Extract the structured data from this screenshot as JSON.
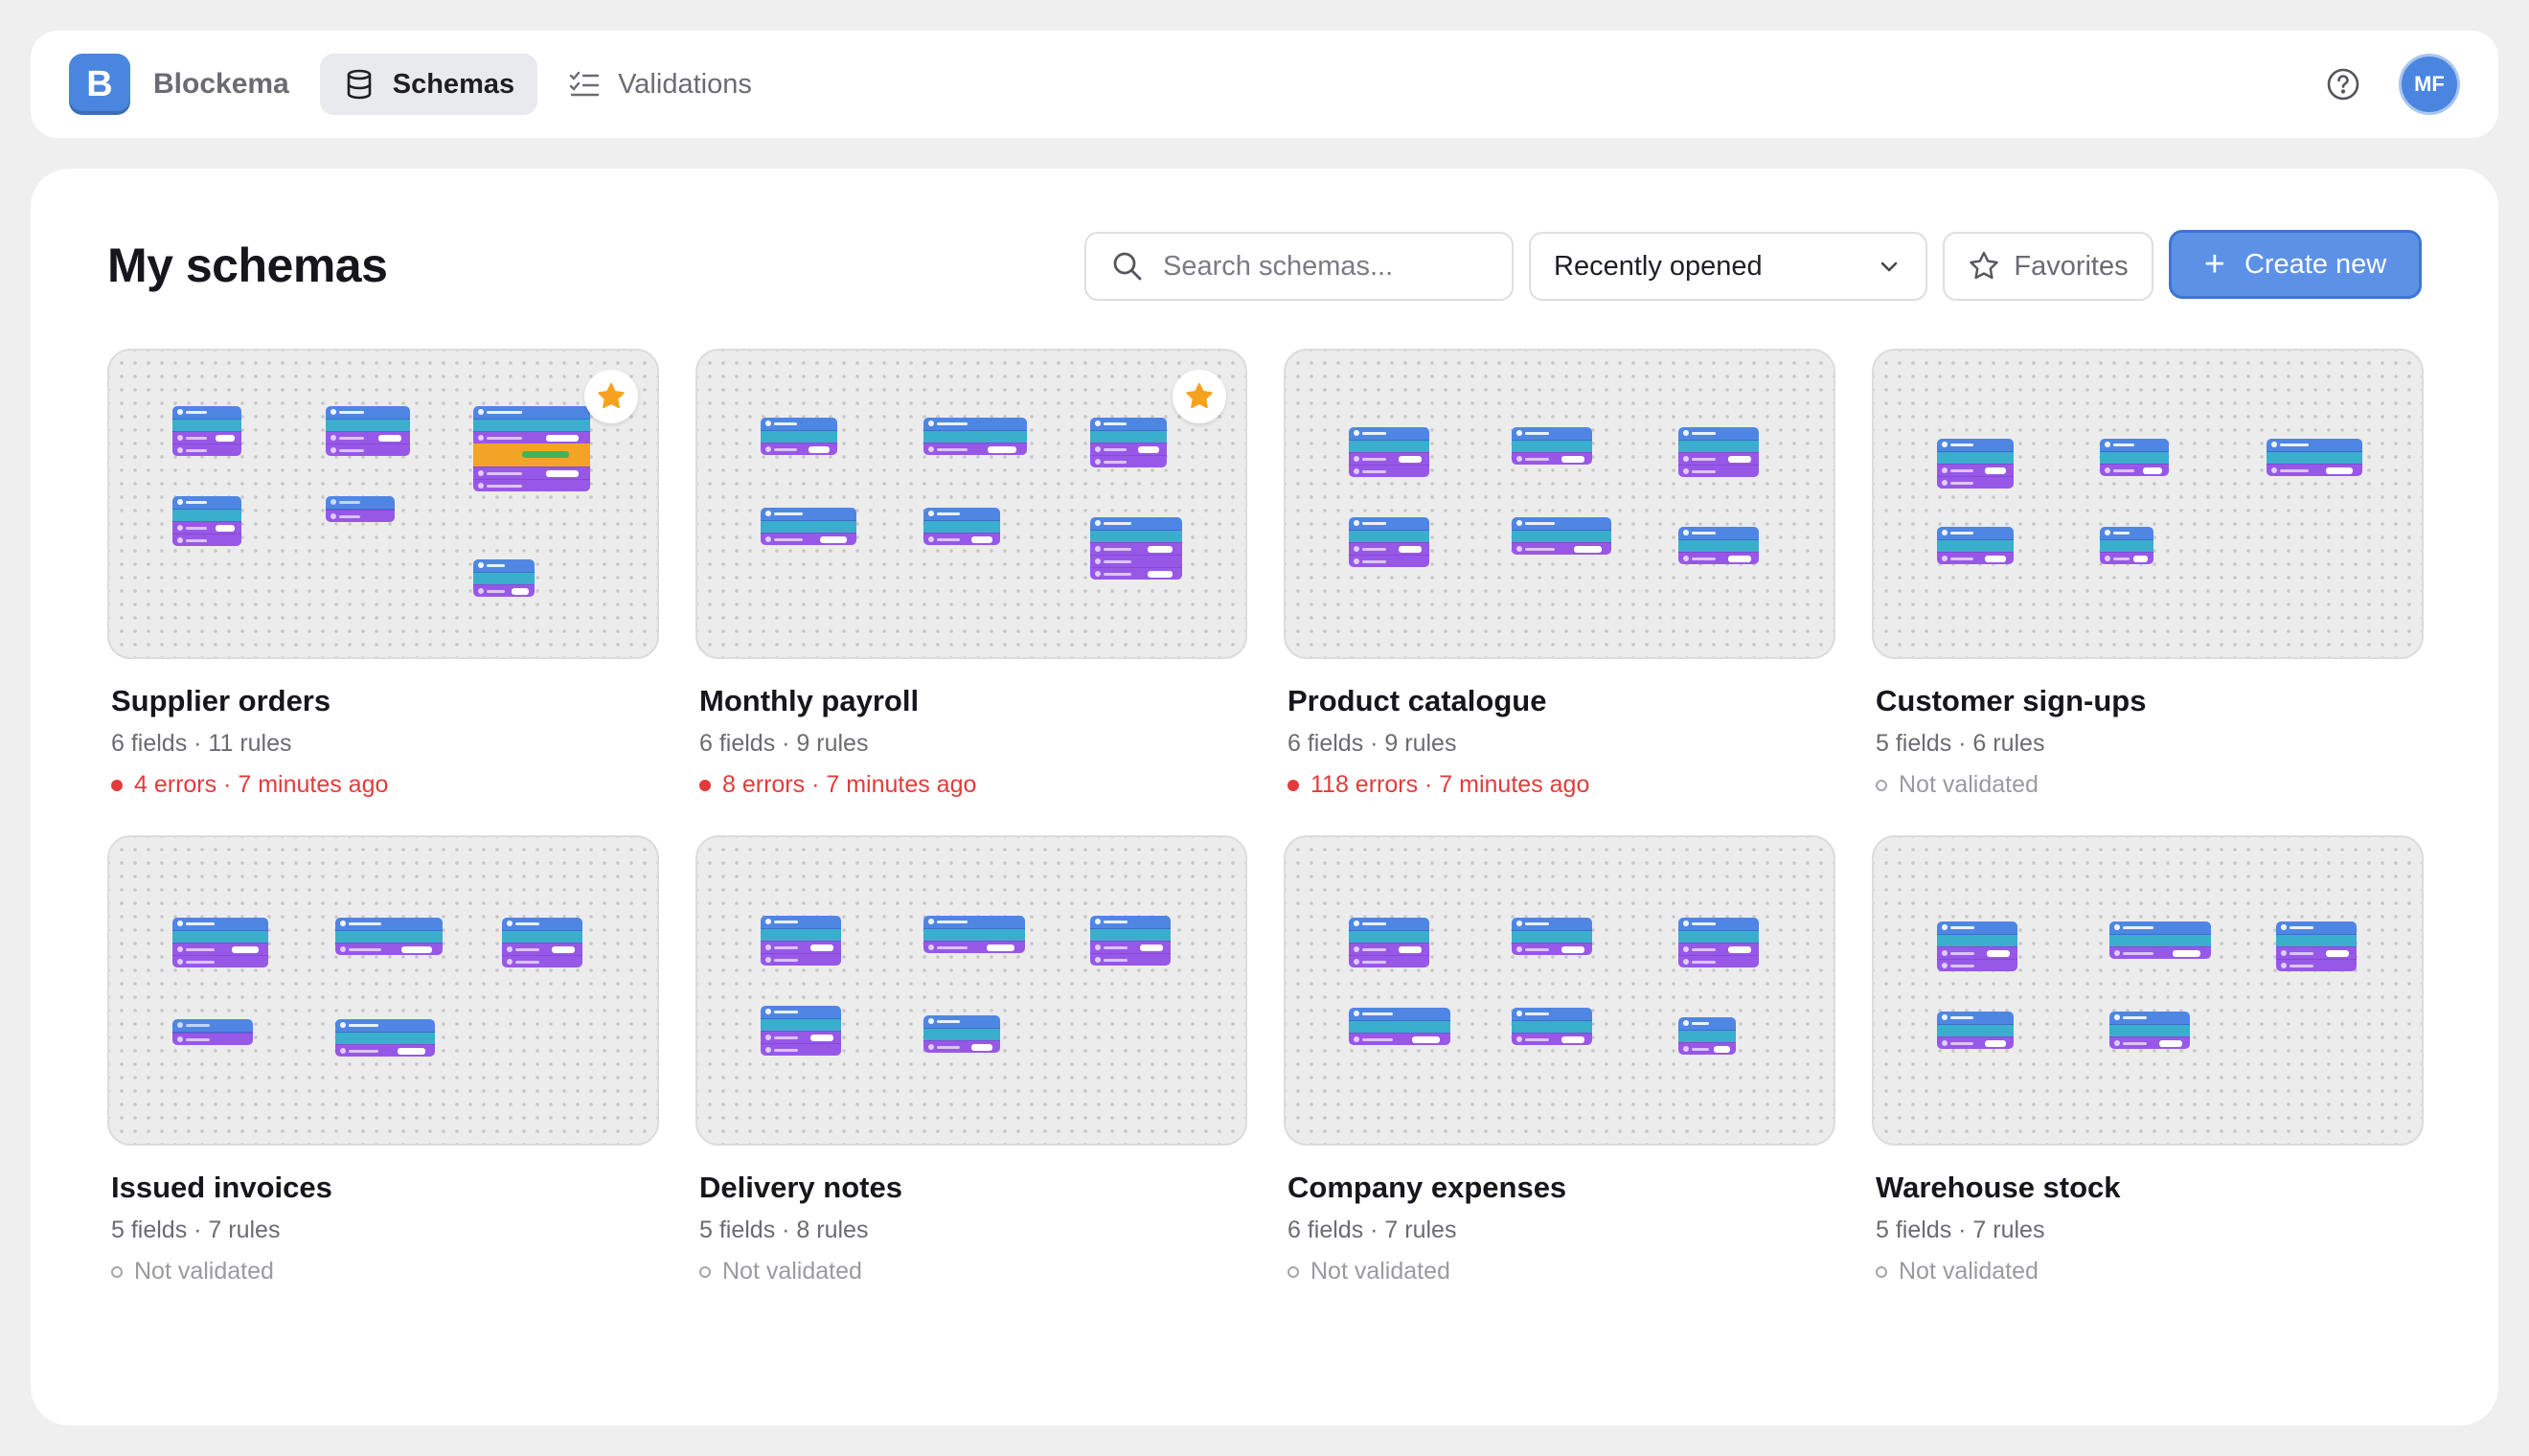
{
  "app": {
    "logo_letter": "B",
    "brand": "Blockema",
    "avatar_initials": "MF",
    "accent": "#4a86e0"
  },
  "nav": {
    "tabs": [
      {
        "label": "Schemas",
        "icon": "database-icon",
        "active": true
      },
      {
        "label": "Validations",
        "icon": "checklist-icon",
        "active": false
      }
    ]
  },
  "page": {
    "title": "My schemas",
    "search_placeholder": "Search schemas...",
    "sort_value": "Recently opened",
    "favorites_label": "Favorites",
    "create_label": "Create new"
  },
  "colors": {
    "error": "#e23b3b",
    "favorite_star": "#f6a21e"
  },
  "schemas": [
    {
      "title": "Supplier orders",
      "meta": "6 fields · 11 rules",
      "status": "4 errors · 7 minutes ago",
      "status_type": "error",
      "favorite": true
    },
    {
      "title": "Monthly payroll",
      "meta": "6 fields · 9 rules",
      "status": "8 errors · 7 minutes ago",
      "status_type": "error",
      "favorite": true
    },
    {
      "title": "Product catalogue",
      "meta": "6 fields · 9 rules",
      "status": "118 errors · 7 minutes ago",
      "status_type": "error",
      "favorite": false
    },
    {
      "title": "Customer sign-ups",
      "meta": "5 fields · 6 rules",
      "status": "Not validated",
      "status_type": "none",
      "favorite": false
    },
    {
      "title": "Issued invoices",
      "meta": "5 fields · 7 rules",
      "status": "Not validated",
      "status_type": "none",
      "favorite": false
    },
    {
      "title": "Delivery notes",
      "meta": "5 fields · 8 rules",
      "status": "Not validated",
      "status_type": "none",
      "favorite": false
    },
    {
      "title": "Company expenses",
      "meta": "6 fields · 7 rules",
      "status": "Not validated",
      "status_type": "none",
      "favorite": false
    },
    {
      "title": "Warehouse stock",
      "meta": "5 fields · 7 rules",
      "status": "Not validated",
      "status_type": "none",
      "favorite": false
    }
  ]
}
